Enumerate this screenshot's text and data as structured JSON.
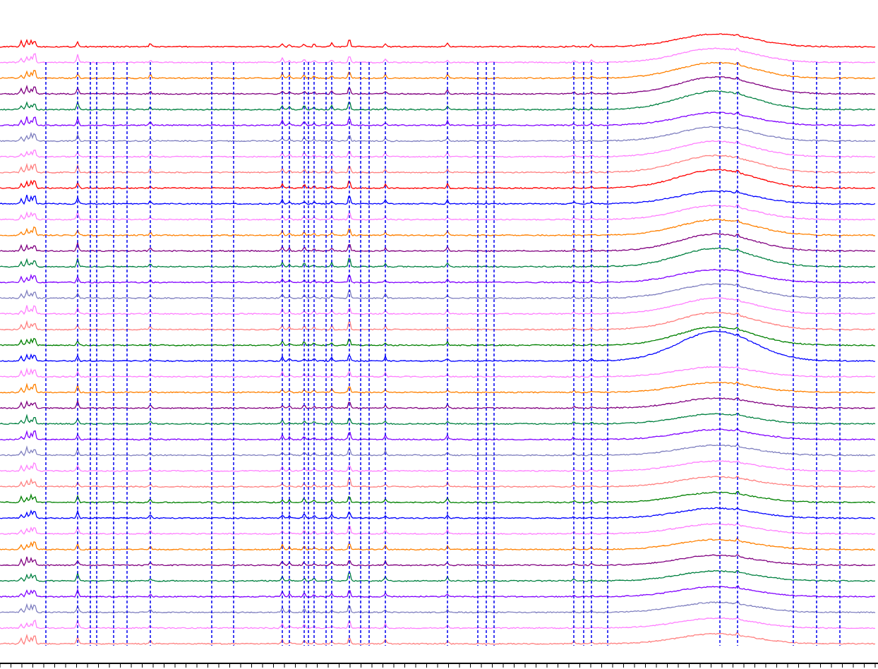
{
  "spectra": [
    {
      "color": "#ff0000"
    },
    {
      "color": "#ff80ff"
    },
    {
      "color": "#ff8000"
    },
    {
      "color": "#800080"
    },
    {
      "color": "#008040"
    },
    {
      "color": "#8000ff"
    },
    {
      "color": "#8080c0"
    },
    {
      "color": "#ff80ff"
    },
    {
      "color": "#ff8080"
    },
    {
      "color": "#ff0000"
    },
    {
      "color": "#0000ff"
    },
    {
      "color": "#ff80ff"
    },
    {
      "color": "#ff8000"
    },
    {
      "color": "#800080"
    },
    {
      "color": "#008040"
    },
    {
      "color": "#8000ff"
    },
    {
      "color": "#8080c0"
    },
    {
      "color": "#ff80ff"
    },
    {
      "color": "#ff8080"
    },
    {
      "color": "#008000"
    },
    {
      "color": "#0000ff"
    },
    {
      "color": "#ff80ff"
    },
    {
      "color": "#ff8000"
    },
    {
      "color": "#800080"
    },
    {
      "color": "#008040"
    },
    {
      "color": "#8000ff"
    },
    {
      "color": "#8080c0"
    },
    {
      "color": "#ff80ff"
    },
    {
      "color": "#ff8080"
    },
    {
      "color": "#008000"
    },
    {
      "color": "#0000ff"
    },
    {
      "color": "#ff80ff"
    },
    {
      "color": "#ff8000"
    },
    {
      "color": "#800080"
    },
    {
      "color": "#008040"
    },
    {
      "color": "#8000ff"
    },
    {
      "color": "#8080c0"
    },
    {
      "color": "#ff80ff"
    },
    {
      "color": "#ff8080"
    }
  ]
}
